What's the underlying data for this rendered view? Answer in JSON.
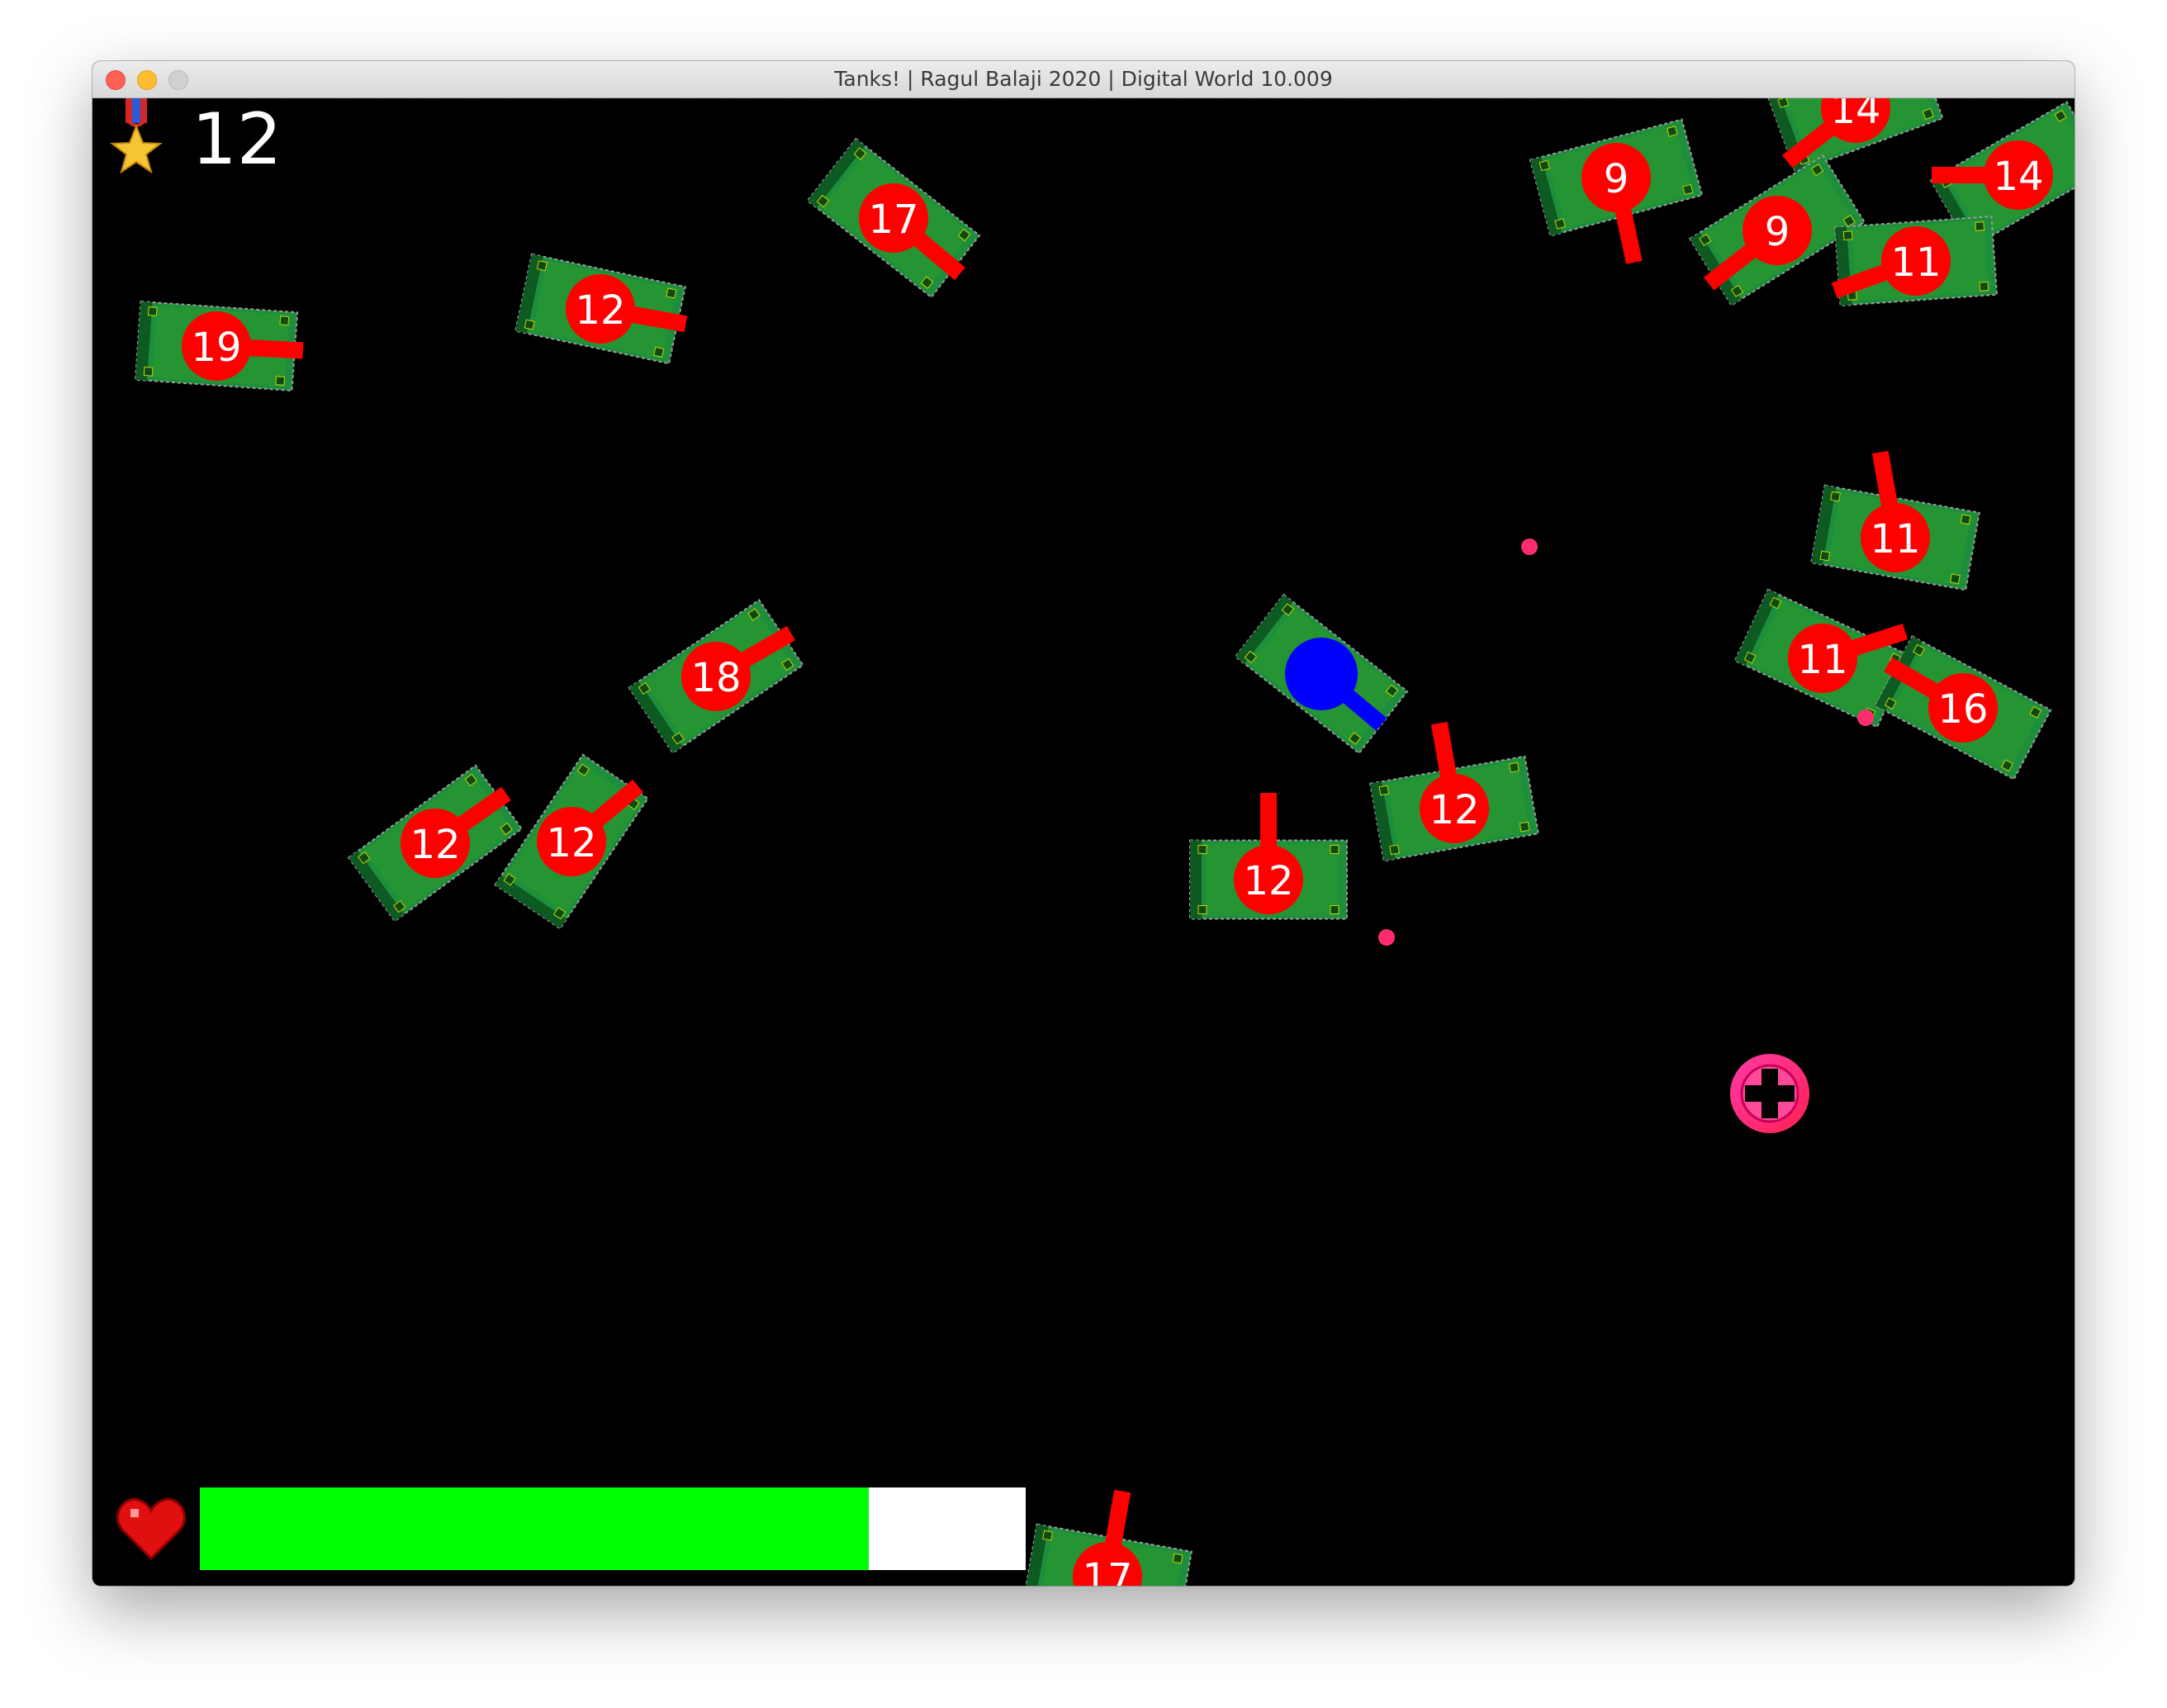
{
  "window": {
    "title": "Tanks! | Ragul Balaji 2020 | Digital World 10.009"
  },
  "hud": {
    "score": "12",
    "score_icon": "medal-star-icon",
    "health_icon": "heart-icon",
    "health_fraction": 0.81,
    "colors": {
      "health_fill": "#00ff00",
      "health_track": "#ffffff"
    }
  },
  "player": {
    "color": "#0000ff"
  },
  "enemy_tanks": [
    {
      "label": "17"
    },
    {
      "label": "12"
    },
    {
      "label": "19"
    },
    {
      "label": "9"
    },
    {
      "label": "14"
    },
    {
      "label": "9"
    },
    {
      "label": "14"
    },
    {
      "label": "11"
    },
    {
      "label": "17"
    },
    {
      "label": "11"
    },
    {
      "label": "11"
    },
    {
      "label": "16"
    },
    {
      "label": "18"
    },
    {
      "label": "12"
    },
    {
      "label": "12"
    },
    {
      "label": "12"
    },
    {
      "label": "12"
    },
    {
      "label": "17"
    }
  ],
  "pickups": [
    {
      "name": "health-pickup",
      "icon": "medical-cross-icon",
      "color": "#ff1f8f"
    }
  ],
  "colors": {
    "enemy_turret": "#ff0000",
    "tank_body": "#1d8f3c",
    "bullet": "#ff2d6e",
    "background": "#000000"
  }
}
